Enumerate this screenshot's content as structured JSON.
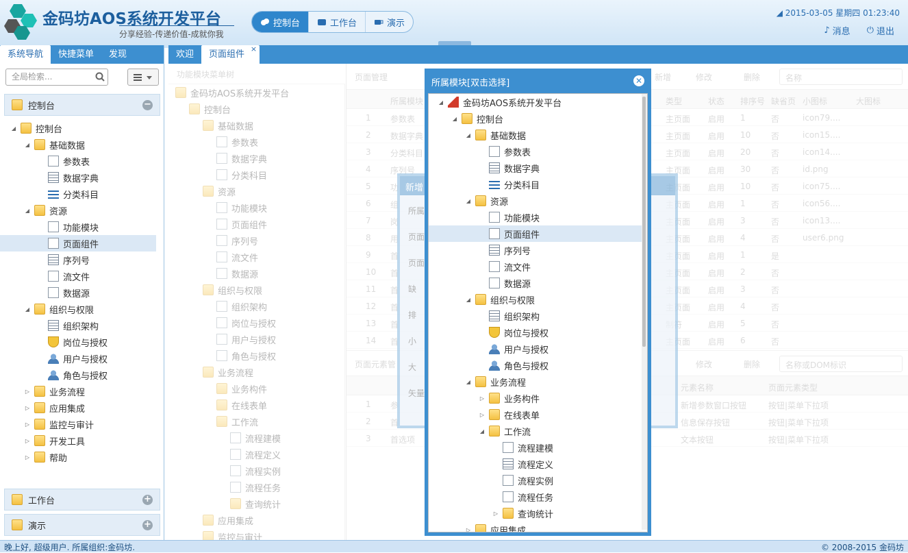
{
  "header": {
    "app_title": "金码坊AOS系统开发平台",
    "slogan": "分享经验-传递价值-成就你我",
    "datetime": "2015-03-05 星期四 01:23:40",
    "messages": "消息",
    "logout": "退出",
    "nav": [
      {
        "label": "控制台",
        "active": true
      },
      {
        "label": "工作台"
      },
      {
        "label": "演示"
      }
    ]
  },
  "left": {
    "tabs": [
      "系统导航",
      "快捷菜单",
      "发现"
    ],
    "search_placeholder": "全局检索...",
    "panels": [
      {
        "label": "控制台",
        "toggle": "−"
      },
      {
        "label": "工作台",
        "toggle": "+"
      },
      {
        "label": "演示",
        "toggle": "+"
      }
    ],
    "tree": [
      {
        "label": "控制台",
        "level": 0,
        "type": "folder",
        "exp": "open"
      },
      {
        "label": "基础数据",
        "level": 1,
        "type": "folder",
        "exp": "open"
      },
      {
        "label": "参数表",
        "level": 2,
        "type": "doc"
      },
      {
        "label": "数据字典",
        "level": 2,
        "type": "grid"
      },
      {
        "label": "分类科目",
        "level": 2,
        "type": "list"
      },
      {
        "label": "资源",
        "level": 1,
        "type": "folder",
        "exp": "open"
      },
      {
        "label": "功能模块",
        "level": 2,
        "type": "doc"
      },
      {
        "label": "页面组件",
        "level": 2,
        "type": "doc",
        "selected": true
      },
      {
        "label": "序列号",
        "level": 2,
        "type": "grid"
      },
      {
        "label": "流文件",
        "level": 2,
        "type": "doc"
      },
      {
        "label": "数据源",
        "level": 2,
        "type": "doc"
      },
      {
        "label": "组织与权限",
        "level": 1,
        "type": "folder",
        "exp": "open"
      },
      {
        "label": "组织架构",
        "level": 2,
        "type": "grid"
      },
      {
        "label": "岗位与授权",
        "level": 2,
        "type": "shield"
      },
      {
        "label": "用户与授权",
        "level": 2,
        "type": "people"
      },
      {
        "label": "角色与授权",
        "level": 2,
        "type": "people"
      },
      {
        "label": "业务流程",
        "level": 1,
        "type": "folder",
        "exp": "closed"
      },
      {
        "label": "应用集成",
        "level": 1,
        "type": "folder",
        "exp": "closed"
      },
      {
        "label": "监控与审计",
        "level": 1,
        "type": "folder",
        "exp": "closed"
      },
      {
        "label": "开发工具",
        "level": 1,
        "type": "folder",
        "exp": "closed"
      },
      {
        "label": "帮助",
        "level": 1,
        "type": "folder",
        "exp": "closed"
      }
    ]
  },
  "center_tabs": [
    "欢迎",
    "页面组件"
  ],
  "module_tree": {
    "title": "功能模块菜单树",
    "items": [
      "金码坊AOS系统开发平台",
      "控制台",
      "基础数据",
      "参数表",
      "数据字典",
      "分类科目",
      "资源",
      "功能模块",
      "页面组件",
      "序列号",
      "流文件",
      "数据源",
      "组织与权限",
      "组织架构",
      "岗位与授权",
      "用户与授权",
      "角色与授权",
      "业务流程",
      "业务构件",
      "在线表单",
      "工作流",
      "流程建模",
      "流程定义",
      "流程实例",
      "流程任务",
      "查询统计",
      "应用集成",
      "监控与审计"
    ]
  },
  "page_grid": {
    "title": "页面管理",
    "buttons": [
      "新增",
      "修改",
      "删除"
    ],
    "search_placeholder": "名称",
    "cols": [
      "所属模块",
      "类型",
      "状态",
      "排序号",
      "缺省页",
      "小图标",
      "大图标"
    ],
    "rows": [
      [
        "1",
        "参数表",
        "主页面",
        "启用",
        "1",
        "否",
        "icon79...."
      ],
      [
        "2",
        "数据字典",
        "主页面",
        "启用",
        "10",
        "否",
        "icon15...."
      ],
      [
        "3",
        "分类科目",
        "主页面",
        "启用",
        "20",
        "否",
        "icon14...."
      ],
      [
        "4",
        "序列号",
        "主页面",
        "启用",
        "30",
        "否",
        "id.png"
      ],
      [
        "5",
        "功",
        "主页面",
        "启用",
        "10",
        "否",
        "icon75...."
      ],
      [
        "6",
        "组",
        "主页面",
        "启用",
        "1",
        "否",
        "icon56...."
      ],
      [
        "7",
        "岗",
        "主页面",
        "启用",
        "3",
        "否",
        "icon13...."
      ],
      [
        "8",
        "用",
        "主页面",
        "启用",
        "4",
        "否",
        "user6.png"
      ],
      [
        "9",
        "首",
        "主页面",
        "启用",
        "1",
        "是",
        ""
      ],
      [
        "10",
        "首",
        "主页面",
        "启用",
        "2",
        "否",
        ""
      ],
      [
        "11",
        "首",
        "主页面",
        "启用",
        "3",
        "否",
        ""
      ],
      [
        "12",
        "首",
        "主页面",
        "启用",
        "4",
        "否",
        ""
      ],
      [
        "13",
        "首",
        "制符",
        "启用",
        "5",
        "否",
        ""
      ],
      [
        "14",
        "首",
        "主页面",
        "启用",
        "6",
        "否",
        ""
      ]
    ]
  },
  "elem_grid": {
    "title": "页面元素管",
    "buttons": [
      "修改",
      "删除"
    ],
    "search_placeholder": "名称或DOM标识",
    "cols": [
      "元素名称",
      "页面元素类型"
    ],
    "rows": [
      [
        "1",
        "参",
        "新增参数窗口按钮",
        "按钮|菜单下拉项"
      ],
      [
        "2",
        "首",
        "信息保存按钮",
        "按钮|菜单下拉项"
      ],
      [
        "3",
        "首选项",
        "文本按钮",
        "按钮|菜单下拉项"
      ]
    ]
  },
  "back_dialog": {
    "title": "新增",
    "labels": [
      "所属",
      "页面",
      "页面",
      "缺",
      "排",
      "小",
      "大",
      "矢量"
    ]
  },
  "dialog": {
    "title": "所属模块[双击选择]",
    "tree": [
      {
        "label": "金码坊AOS系统开发平台",
        "level": 0,
        "type": "house",
        "exp": "open"
      },
      {
        "label": "控制台",
        "level": 1,
        "type": "folder",
        "exp": "open"
      },
      {
        "label": "基础数据",
        "level": 2,
        "type": "folder",
        "exp": "open"
      },
      {
        "label": "参数表",
        "level": 3,
        "type": "doc"
      },
      {
        "label": "数据字典",
        "level": 3,
        "type": "grid"
      },
      {
        "label": "分类科目",
        "level": 3,
        "type": "list"
      },
      {
        "label": "资源",
        "level": 2,
        "type": "folder",
        "exp": "open"
      },
      {
        "label": "功能模块",
        "level": 3,
        "type": "doc"
      },
      {
        "label": "页面组件",
        "level": 3,
        "type": "doc",
        "selected": true
      },
      {
        "label": "序列号",
        "level": 3,
        "type": "grid"
      },
      {
        "label": "流文件",
        "level": 3,
        "type": "doc"
      },
      {
        "label": "数据源",
        "level": 3,
        "type": "doc"
      },
      {
        "label": "组织与权限",
        "level": 2,
        "type": "folder",
        "exp": "open"
      },
      {
        "label": "组织架构",
        "level": 3,
        "type": "grid"
      },
      {
        "label": "岗位与授权",
        "level": 3,
        "type": "shield"
      },
      {
        "label": "用户与授权",
        "level": 3,
        "type": "people"
      },
      {
        "label": "角色与授权",
        "level": 3,
        "type": "people"
      },
      {
        "label": "业务流程",
        "level": 2,
        "type": "folder",
        "exp": "open"
      },
      {
        "label": "业务构件",
        "level": 3,
        "type": "folder",
        "exp": "closed"
      },
      {
        "label": "在线表单",
        "level": 3,
        "type": "folder",
        "exp": "closed"
      },
      {
        "label": "工作流",
        "level": 3,
        "type": "folder",
        "exp": "open"
      },
      {
        "label": "流程建模",
        "level": 4,
        "type": "doc"
      },
      {
        "label": "流程定义",
        "level": 4,
        "type": "grid"
      },
      {
        "label": "流程实例",
        "level": 4,
        "type": "doc"
      },
      {
        "label": "流程任务",
        "level": 4,
        "type": "doc"
      },
      {
        "label": "查询统计",
        "level": 4,
        "type": "folder",
        "exp": "closed"
      },
      {
        "label": "应用集成",
        "level": 2,
        "type": "folder",
        "exp": "closed"
      }
    ]
  },
  "status": {
    "left": "晚上好, 超级用户. 所属组织:金码坊.",
    "right": "© 2008-2015 金码坊"
  }
}
